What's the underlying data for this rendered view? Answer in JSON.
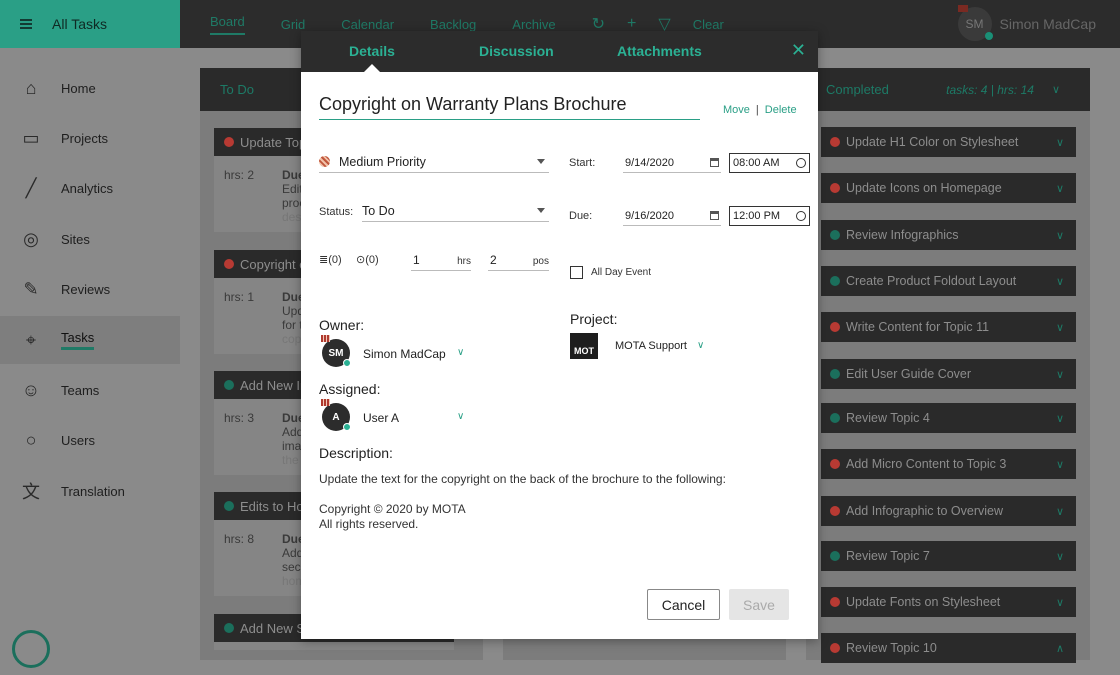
{
  "app": {
    "title": "All Tasks"
  },
  "nav": {
    "board": "Board",
    "grid": "Grid",
    "calendar": "Calendar",
    "backlog": "Backlog",
    "archive": "Archive",
    "clear": "Clear"
  },
  "user": {
    "initials": "SM",
    "name": "Simon MadCap"
  },
  "sidebar": {
    "items": [
      {
        "label": "Home",
        "icon": "home-icon"
      },
      {
        "label": "Projects",
        "icon": "folder-icon"
      },
      {
        "label": "Analytics",
        "icon": "chart-icon"
      },
      {
        "label": "Sites",
        "icon": "globe-icon"
      },
      {
        "label": "Reviews",
        "icon": "pen-icon"
      },
      {
        "label": "Tasks",
        "icon": "pin-icon"
      },
      {
        "label": "Teams",
        "icon": "people-icon"
      },
      {
        "label": "Users",
        "icon": "user-icon"
      },
      {
        "label": "Translation",
        "icon": "translate-icon"
      }
    ]
  },
  "board": {
    "todo": {
      "title": "To Do",
      "cards": [
        {
          "title": "Update Top",
          "hrs": "hrs: 2",
          "due": "Due",
          "lines": [
            "Edit",
            "proc",
            "desc"
          ],
          "color": "#b83a33"
        },
        {
          "title": "Copyright o",
          "hrs": "hrs: 1",
          "due": "Due",
          "lines": [
            "Upd",
            "for t",
            "copy"
          ],
          "color": "#b83a33"
        },
        {
          "title": "Add New In",
          "hrs": "hrs: 3",
          "due": "Due",
          "lines": [
            "Add",
            "ima",
            "the"
          ],
          "color": "#1b6f5c"
        },
        {
          "title": "Edits to Ho",
          "hrs": "hrs: 8",
          "due": "Due",
          "lines": [
            "Add",
            "sec",
            "hom"
          ],
          "color": "#1b6f5c"
        },
        {
          "title": "Add New S",
          "color": "#1b6f5c"
        }
      ]
    },
    "completed": {
      "title": "Completed",
      "meta": "tasks: 4 | hrs: 14",
      "cards": [
        {
          "title": "Update H1 Color on Stylesheet",
          "color": "#b83a33"
        },
        {
          "title": "Update Icons on Homepage",
          "color": "#b83a33"
        },
        {
          "title": "Review Infographics",
          "color": "#1b6f5c"
        },
        {
          "title": "Create Product Foldout Layout",
          "color": "#1b6f5c"
        },
        {
          "title": "Write Content for Topic 11",
          "color": "#b83a33"
        },
        {
          "title": "Edit User Guide Cover",
          "color": "#1b6f5c"
        },
        {
          "title": "Review Topic 4",
          "color": "#1b6f5c"
        },
        {
          "title": "Add Micro Content to Topic 3",
          "color": "#b83a33"
        },
        {
          "title": "Add Infographic to Overview",
          "color": "#b83a33"
        },
        {
          "title": "Review Topic 7",
          "color": "#1b6f5c"
        },
        {
          "title": "Update Fonts on Stylesheet",
          "color": "#b83a33"
        },
        {
          "title": "Review Topic 10",
          "color": "#b83a33"
        }
      ]
    }
  },
  "modal": {
    "tabs": {
      "details": "Details",
      "discussion": "Discussion",
      "attachments": "Attachments"
    },
    "task_title": "Copyright on Warranty Plans Brochure",
    "move": "Move",
    "delete": "Delete",
    "priority": "Medium Priority",
    "status_label": "Status:",
    "status": "To Do",
    "start_label": "Start:",
    "start_date": "9/14/2020",
    "start_time": "08:00 AM",
    "due_label": "Due:",
    "due_date": "9/16/2020",
    "due_time": "12:00 PM",
    "comments": "(0)",
    "attachments_count": "(0)",
    "hrs_value": "1",
    "hrs_unit": "hrs",
    "pos_value": "2",
    "pos_unit": "pos",
    "all_day": "All Day Event",
    "owner_label": "Owner:",
    "owner_initials": "SM",
    "owner_name": "Simon MadCap",
    "project_label": "Project:",
    "project_logo": "MOT",
    "project_name": "MOTA Support",
    "assigned_label": "Assigned:",
    "assigned_initials": "A",
    "assigned_name": "User A",
    "description_label": "Description:",
    "description_1": "Update the text for the copyright on the back of the brochure to the following:",
    "description_2": "Copyright © 2020 by MOTA",
    "description_3": "All rights reserved.",
    "cancel": "Cancel",
    "save": "Save"
  },
  "colors": {
    "accent": "#2a9f86",
    "red_dot": "#b83a33",
    "green_dot": "#1b6f5c"
  }
}
